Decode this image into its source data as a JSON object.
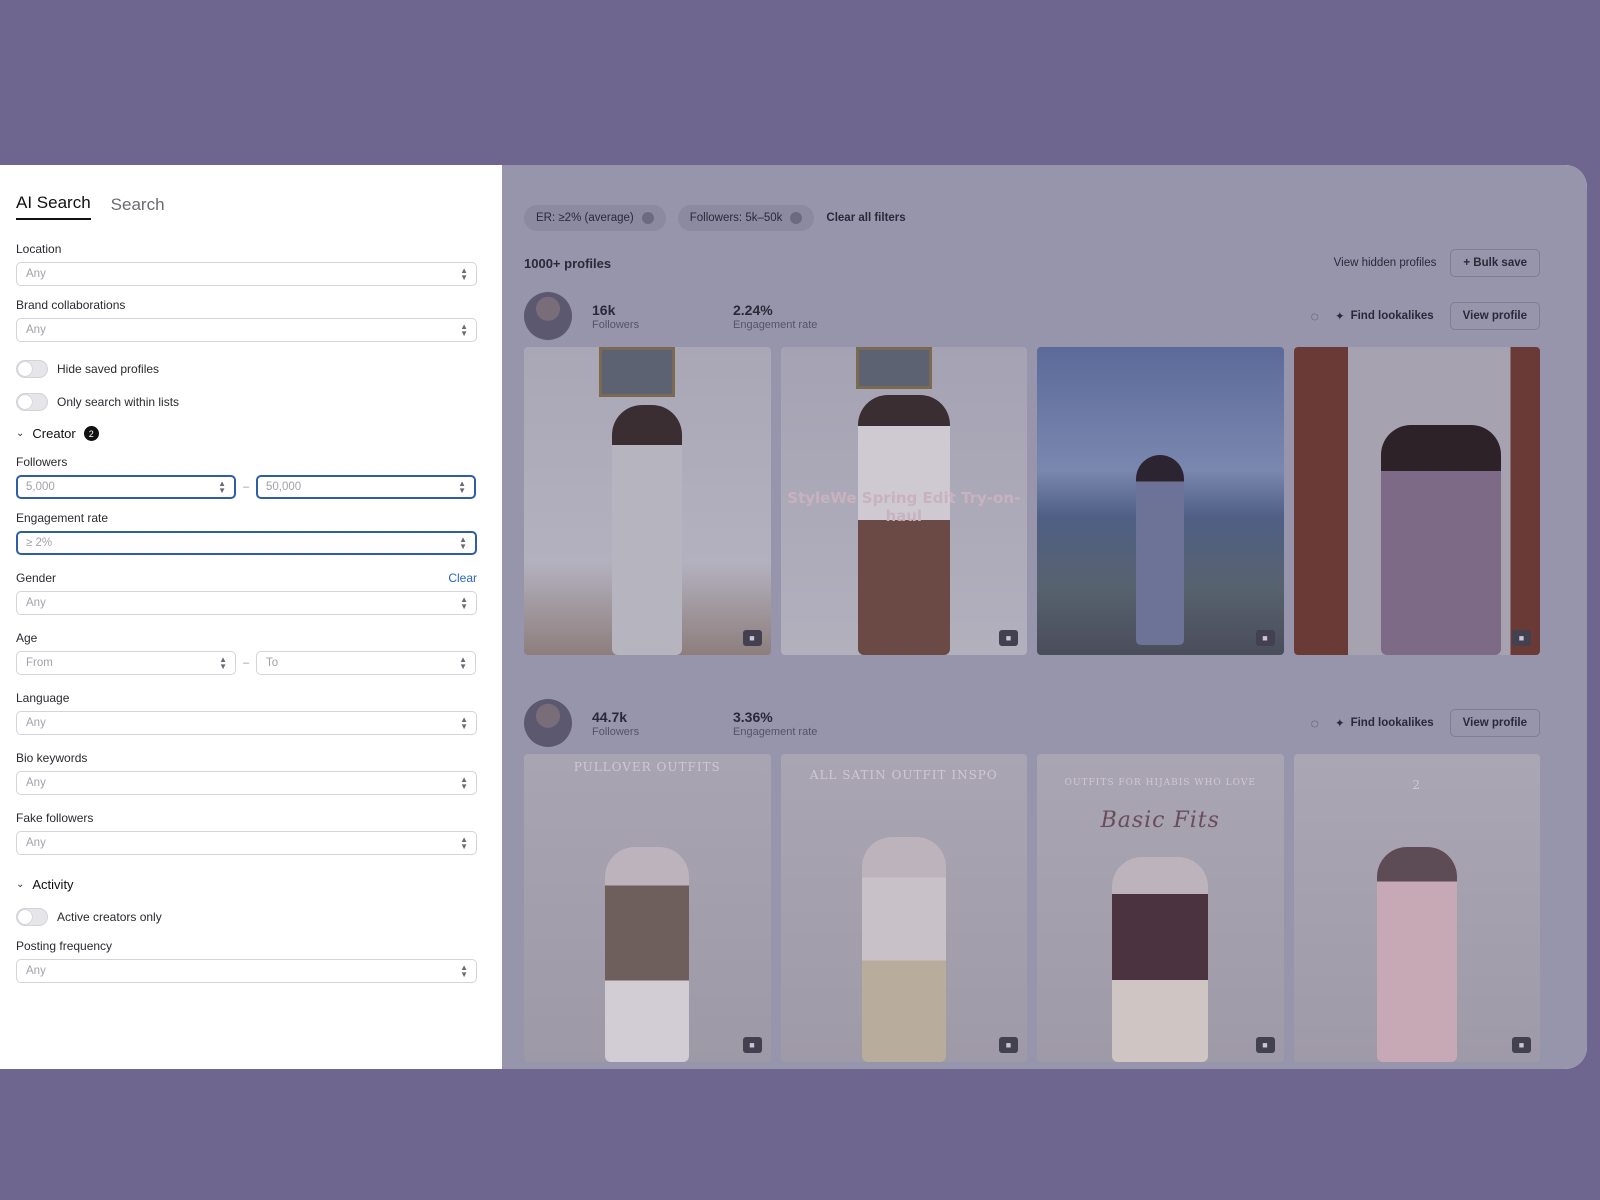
{
  "tabs": [
    {
      "label": "AI Search",
      "active": true
    },
    {
      "label": "Search",
      "active": false
    }
  ],
  "filters": {
    "location": {
      "label": "Location",
      "placeholder": "Any"
    },
    "brand": {
      "label": "Brand collaborations",
      "placeholder": "Any"
    },
    "hide_saved": {
      "label": "Hide saved profiles",
      "on": false
    },
    "only_lists": {
      "label": "Only search within lists",
      "on": false
    },
    "creator_section": {
      "label": "Creator",
      "badge": "2"
    },
    "followers": {
      "label": "Followers",
      "from": "5,000",
      "to": "50,000",
      "sep": "–"
    },
    "engagement": {
      "label": "Engagement rate",
      "value": "≥ 2%"
    },
    "gender": {
      "label": "Gender",
      "placeholder": "Any",
      "clear": "Clear"
    },
    "age": {
      "label": "Age",
      "from": "From",
      "to": "To",
      "sep": "–"
    },
    "language": {
      "label": "Language",
      "placeholder": "Any"
    },
    "bio": {
      "label": "Bio keywords",
      "placeholder": "Any"
    },
    "fake": {
      "label": "Fake followers",
      "placeholder": "Any"
    },
    "activity_section": {
      "label": "Activity"
    },
    "active_only": {
      "label": "Active creators only",
      "on": false
    },
    "posting": {
      "label": "Posting frequency",
      "placeholder": "Any"
    }
  },
  "main": {
    "chips": [
      {
        "label": "ER: ≥2% (average)"
      },
      {
        "label": "Followers: 5k–50k"
      }
    ],
    "clear_all": "Clear all filters",
    "count": "1000+ profiles",
    "view_hidden": "View hidden profiles",
    "bulk_save": "+ Bulk save",
    "find_lookalikes": "Find lookalikes",
    "view_profile": "View profile",
    "followers_label": "Followers",
    "engagement_label": "Engagement rate",
    "profiles": [
      {
        "followers": "16k",
        "engagement": "2.24%",
        "photos": [
          {
            "caption": ""
          },
          {
            "caption": "StyleWe Spring Edit Try-on-haul"
          },
          {
            "caption": ""
          },
          {
            "caption": ""
          }
        ]
      },
      {
        "followers": "44.7k",
        "engagement": "3.36%",
        "photos": [
          {
            "caption": "PULLOVER OUTFITS"
          },
          {
            "caption": "ALL SATIN OUTFIT INSPO"
          },
          {
            "caption": "OUTFITS FOR HIJABIS WHO LOVE",
            "script": "Basic Fits"
          },
          {
            "caption": "2"
          }
        ]
      }
    ]
  }
}
